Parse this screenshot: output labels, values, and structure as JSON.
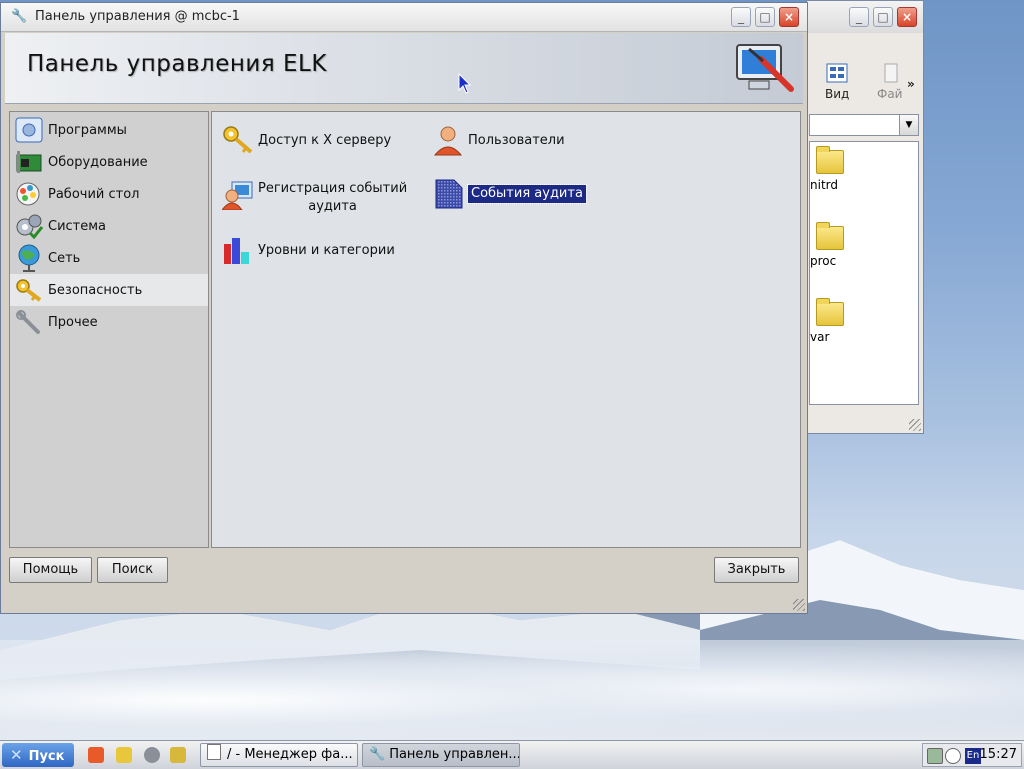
{
  "background_window": {
    "toolbar": [
      {
        "label": "Вид",
        "icon": "view-icon"
      },
      {
        "label": "Фай",
        "icon": "file-icon"
      }
    ],
    "overflow": "»",
    "files": [
      {
        "name": "nitrd",
        "icon": "folder-icon"
      },
      {
        "name": "proc",
        "icon": "folder-icon"
      },
      {
        "name": "var",
        "icon": "folder-icon"
      }
    ]
  },
  "window": {
    "title": "Панель управления @ mcbc-1",
    "banner_title": "Панель управления ELK"
  },
  "sidebar": {
    "items": [
      {
        "label": "Программы",
        "icon": "programs-icon"
      },
      {
        "label": "Оборудование",
        "icon": "hardware-icon"
      },
      {
        "label": "Рабочий стол",
        "icon": "desktop-icon"
      },
      {
        "label": "Система",
        "icon": "system-icon"
      },
      {
        "label": "Сеть",
        "icon": "network-icon"
      },
      {
        "label": "Безопасность",
        "icon": "security-icon",
        "selected": true
      },
      {
        "label": "Прочее",
        "icon": "other-icon"
      }
    ]
  },
  "content": {
    "items": [
      {
        "label": "Доступ к X серверу",
        "icon": "key-icon"
      },
      {
        "label": "Пользователи",
        "icon": "user-icon"
      },
      {
        "label_line1": "Регистрация событий",
        "label_line2": "аудита",
        "icon": "event-log-icon"
      },
      {
        "label": "События аудита",
        "icon": "audit-events-icon",
        "selected": true
      },
      {
        "label": "Уровни и категории",
        "icon": "levels-icon"
      }
    ]
  },
  "buttons": {
    "help": "Помощь",
    "search": "Поиск",
    "close": "Закрыть"
  },
  "taskbar": {
    "start": "Пуск",
    "tasks": [
      {
        "label": "/ - Менеджер фа..."
      },
      {
        "label": "Панель управлен...",
        "active": true
      }
    ],
    "layout": "En",
    "clock": "15:27"
  }
}
